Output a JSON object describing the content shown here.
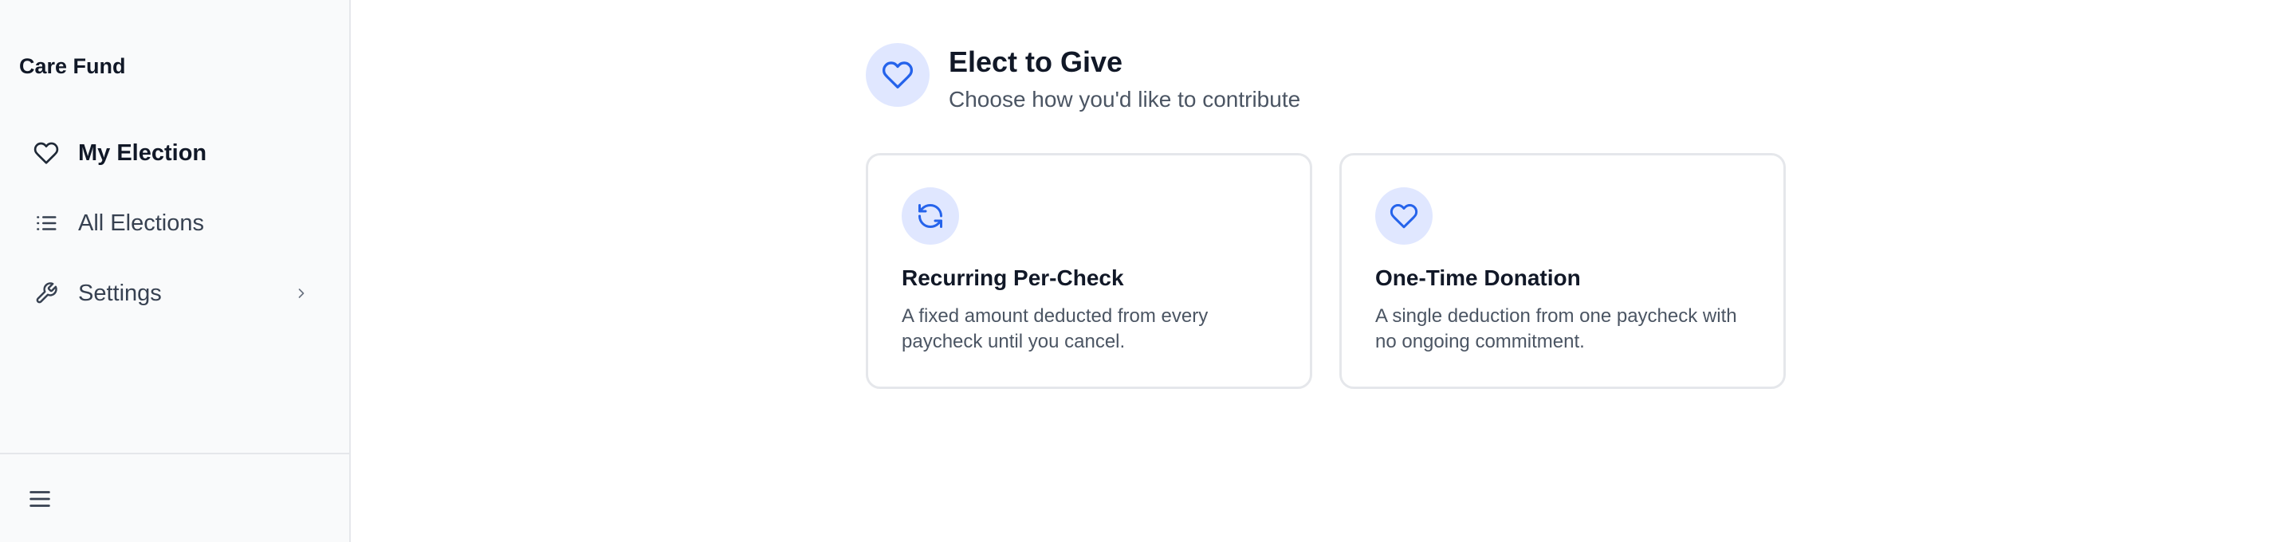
{
  "sidebar": {
    "brand": "Care Fund",
    "items": [
      {
        "label": "My Election",
        "icon": "heart-icon",
        "active": true
      },
      {
        "label": "All Elections",
        "icon": "list-icon",
        "active": false
      },
      {
        "label": "Settings",
        "icon": "wrench-icon",
        "active": false
      }
    ],
    "footer_icon": "menu-icon"
  },
  "header": {
    "icon": "heart-icon",
    "title": "Elect to Give",
    "subtitle": "Choose how you'd like to contribute"
  },
  "cards": [
    {
      "icon": "refresh-icon",
      "title": "Recurring Per-Check",
      "description": "A fixed amount deducted from every paycheck until you cancel."
    },
    {
      "icon": "heart-icon",
      "title": "One-Time Donation",
      "description": "A single deduction from one paycheck with no ongoing commitment."
    }
  ],
  "colors": {
    "accent": "#2563eb",
    "accent_bg": "#e0e7ff",
    "sidebar_bg": "#f9fafb",
    "border": "#e5e7eb"
  }
}
